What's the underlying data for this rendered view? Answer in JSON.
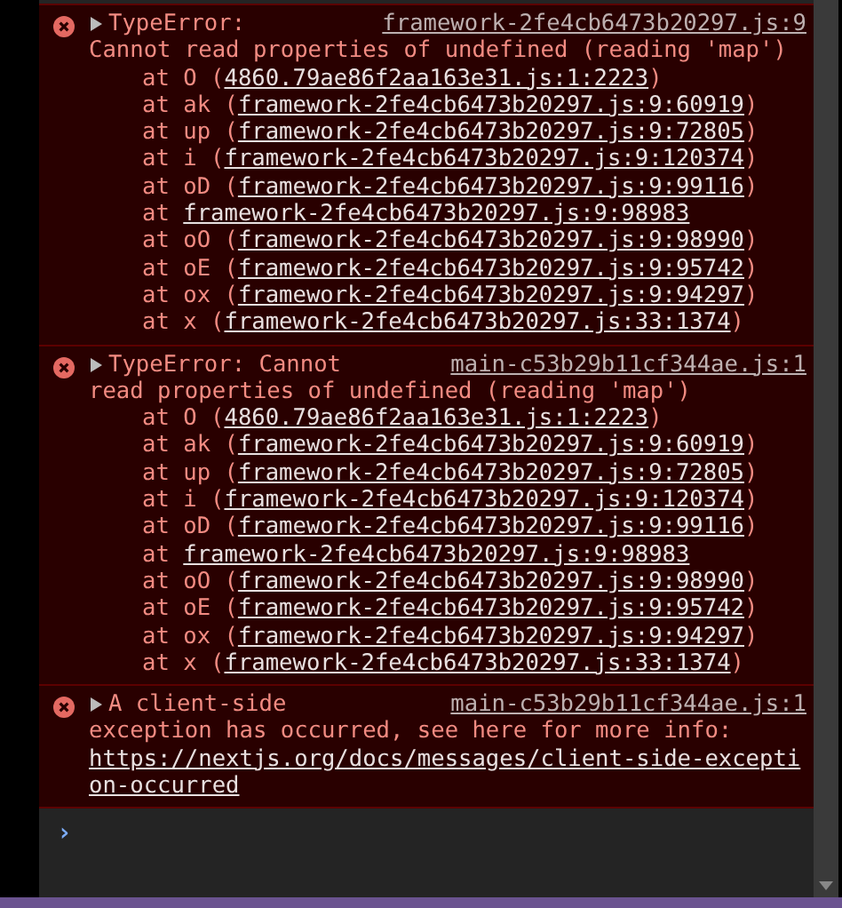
{
  "console": {
    "messages": [
      {
        "expanded": false,
        "head": "TypeError:",
        "text": "Cannot read properties of undefined (reading 'map')",
        "source": "framework-2fe4cb6473b20297.js:9",
        "stack": [
          {
            "call": "at O (",
            "location": "4860.79ae86f2aa163e31.js:1:2223",
            "close": ")"
          },
          {
            "call": "at ak (",
            "location": "framework-2fe4cb6473b20297.js:9:60919",
            "close": ")"
          },
          {
            "call": "at up (",
            "location": "framework-2fe4cb6473b20297.js:9:72805",
            "close": ")"
          },
          {
            "call": "at i (",
            "location": "framework-2fe4cb6473b20297.js:9:120374",
            "close": ")"
          },
          {
            "call": "at oD (",
            "location": "framework-2fe4cb6473b20297.js:9:99116",
            "close": ")"
          },
          {
            "call": "at",
            "location": "framework-2fe4cb6473b20297.js:9:98983"
          },
          {
            "call": "at oO (",
            "location": "framework-2fe4cb6473b20297.js:9:98990",
            "close": ")"
          },
          {
            "call": "at oE (",
            "location": "framework-2fe4cb6473b20297.js:9:95742",
            "close": ")"
          },
          {
            "call": "at ox (",
            "location": "framework-2fe4cb6473b20297.js:9:94297",
            "close": ")"
          },
          {
            "call": "at x (",
            "location": "framework-2fe4cb6473b20297.js:33:1374",
            "close": ")"
          }
        ]
      },
      {
        "expanded": false,
        "head": "TypeError: Cannot",
        "text": "read properties of undefined (reading 'map')",
        "source": "main-c53b29b11cf344ae.js:1",
        "stack": [
          {
            "call": "at O (",
            "location": "4860.79ae86f2aa163e31.js:1:2223",
            "close": ")"
          },
          {
            "call": "at ak (",
            "location": "framework-2fe4cb6473b20297.js:9:60919",
            "close": ")"
          },
          {
            "call": "at up (",
            "location": "framework-2fe4cb6473b20297.js:9:72805",
            "close": ")"
          },
          {
            "call": "at i (",
            "location": "framework-2fe4cb6473b20297.js:9:120374",
            "close": ")"
          },
          {
            "call": "at oD (",
            "location": "framework-2fe4cb6473b20297.js:9:99116",
            "close": ")"
          },
          {
            "call": "at",
            "location": "framework-2fe4cb6473b20297.js:9:98983"
          },
          {
            "call": "at oO (",
            "location": "framework-2fe4cb6473b20297.js:9:98990",
            "close": ")"
          },
          {
            "call": "at oE (",
            "location": "framework-2fe4cb6473b20297.js:9:95742",
            "close": ")"
          },
          {
            "call": "at ox (",
            "location": "framework-2fe4cb6473b20297.js:9:94297",
            "close": ")"
          },
          {
            "call": "at x (",
            "location": "framework-2fe4cb6473b20297.js:33:1374",
            "close": ")"
          }
        ]
      },
      {
        "expanded": false,
        "head": "A client-side",
        "text": "exception has occurred, see here for more info:",
        "link": "https://nextjs.org/docs/messages/client-side-exception-occurred",
        "source": "main-c53b29b11cf344ae.js:1"
      }
    ]
  },
  "prompt": {
    "symbol": "›"
  }
}
